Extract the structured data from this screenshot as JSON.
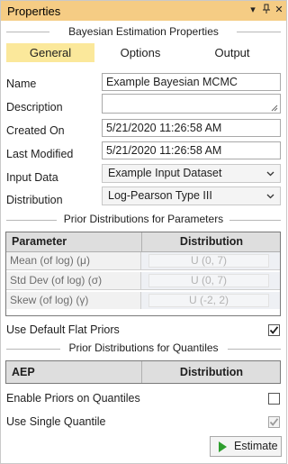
{
  "panel": {
    "title": "Properties",
    "dropdown_glyph": "▾",
    "pin_glyph": "ᵖ",
    "close_glyph": "✕"
  },
  "section_title": "Bayesian Estimation Properties",
  "tabs": [
    {
      "label": "General",
      "active": true
    },
    {
      "label": "Options",
      "active": false
    },
    {
      "label": "Output",
      "active": false
    }
  ],
  "fields": {
    "name": {
      "label": "Name",
      "value": "Example Bayesian MCMC"
    },
    "description": {
      "label": "Description",
      "value": ""
    },
    "created_on": {
      "label": "Created On",
      "value": "5/21/2020 11:26:58 AM"
    },
    "last_modified": {
      "label": "Last Modified",
      "value": "5/21/2020 11:26:58 AM"
    },
    "input_data": {
      "label": "Input Data",
      "value": "Example Input Dataset"
    },
    "distribution": {
      "label": "Distribution",
      "value": "Log-Pearson Type III"
    }
  },
  "prior_params": {
    "title": "Prior Distributions for Parameters",
    "columns": [
      "Parameter",
      "Distribution"
    ],
    "rows": [
      {
        "parameter": "Mean (of log) (μ)",
        "distribution": "U (0, 7)"
      },
      {
        "parameter": "Std Dev (of log) (σ)",
        "distribution": "U (0, 7)"
      },
      {
        "parameter": "Skew (of log) (γ)",
        "distribution": "U (-2, 2)"
      }
    ]
  },
  "use_default_flat_priors": {
    "label": "Use Default Flat Priors",
    "checked": true
  },
  "prior_quantiles": {
    "title": "Prior Distributions for Quantiles",
    "columns": [
      "AEP",
      "Distribution"
    ]
  },
  "enable_priors_on_quantiles": {
    "label": "Enable Priors on Quantiles",
    "checked": false
  },
  "use_single_quantile": {
    "label": "Use Single Quantile",
    "checked": true,
    "disabled": true
  },
  "estimate_button": {
    "label": "Estimate"
  },
  "colors": {
    "titlebar": "#f5cc84",
    "active_tab": "#fbe89b",
    "play_icon": "#2e9e2e"
  }
}
